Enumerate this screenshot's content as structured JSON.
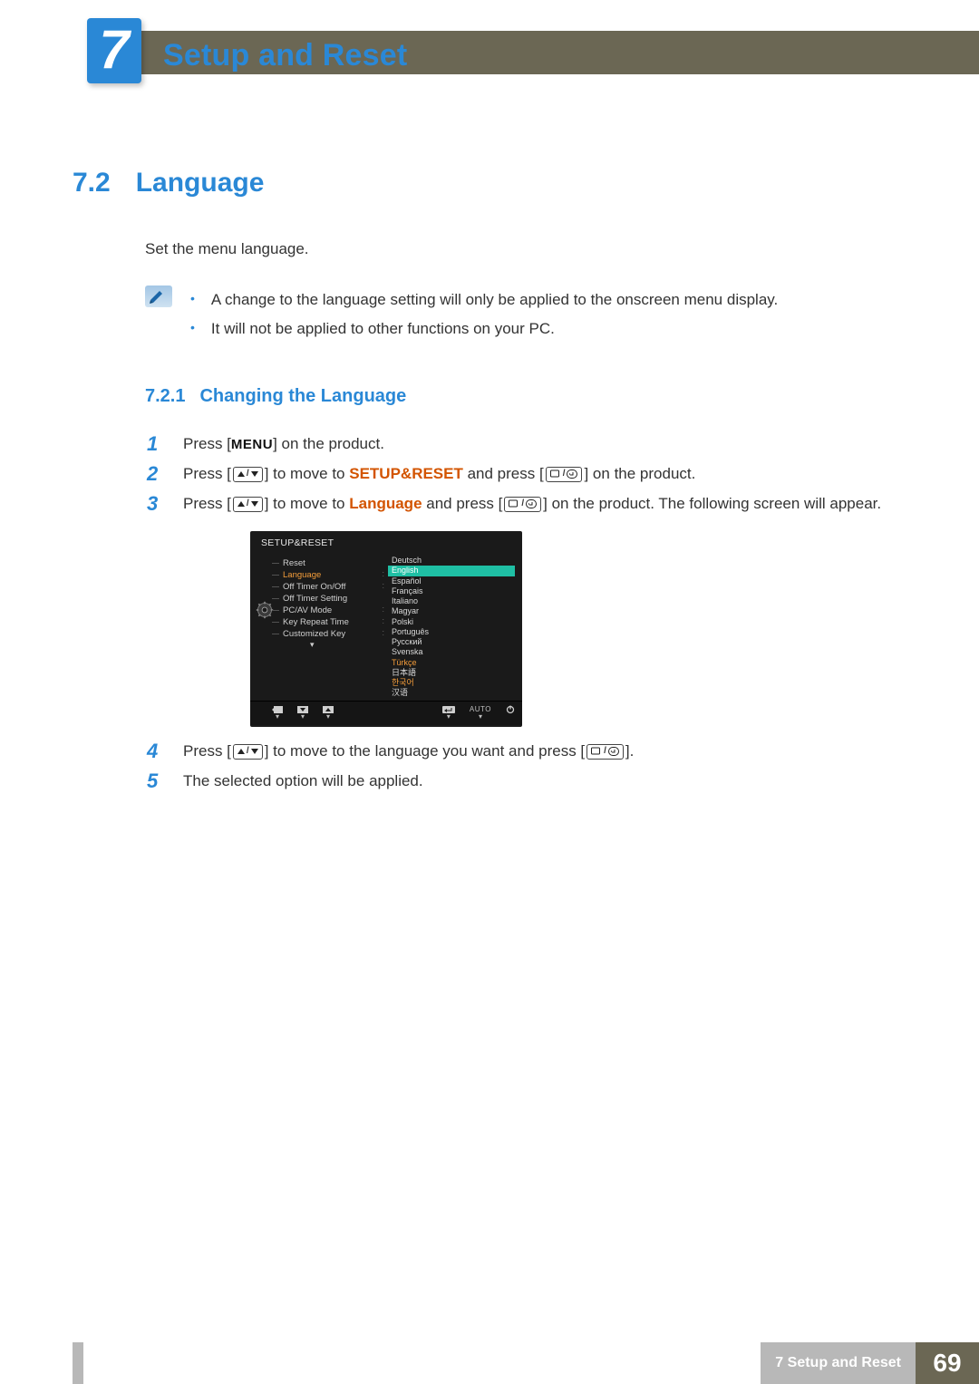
{
  "chapter": {
    "number": "7",
    "title": "Setup and Reset"
  },
  "section": {
    "number": "7.2",
    "title": "Language"
  },
  "intro": "Set the menu language.",
  "notes": [
    "A change to the language setting will only be applied to the onscreen menu display.",
    "It will not be applied to other functions on your PC."
  ],
  "subsection": {
    "number": "7.2.1",
    "title": "Changing the Language"
  },
  "steps": {
    "1": {
      "a": "Press [",
      "menu": "MENU",
      "b": "] on the product."
    },
    "2": {
      "a": "Press [",
      "b": "] to move to ",
      "kw": "SETUP&RESET",
      "c": " and press [",
      "d": "] on the product."
    },
    "3": {
      "a": "Press [",
      "b": "] to move to ",
      "kw": "Language",
      "c": " and press [",
      "d": "] on the product. The following screen will appear."
    },
    "4": {
      "a": "Press [",
      "b": "] to move to the language you want and press [",
      "c": "]."
    },
    "5": {
      "a": "The selected option will be applied."
    }
  },
  "osd": {
    "title": "SETUP&RESET",
    "menu": [
      "Reset",
      "Language",
      "Off Timer On/Off",
      "Off Timer Setting",
      "PC/AV Mode",
      "Key Repeat Time",
      "Customized Key"
    ],
    "selected_menu_index": 1,
    "languages": [
      "Deutsch",
      "English",
      "Español",
      "Français",
      "Italiano",
      "Magyar",
      "Polski",
      "Português",
      "Русский",
      "Svenska",
      "Türkçe",
      "日本語",
      "한국어",
      "汉语"
    ],
    "highlighted_language_index": 1,
    "bottom_auto": "AUTO"
  },
  "footer": {
    "section": "7 Setup and Reset",
    "page": "69"
  }
}
